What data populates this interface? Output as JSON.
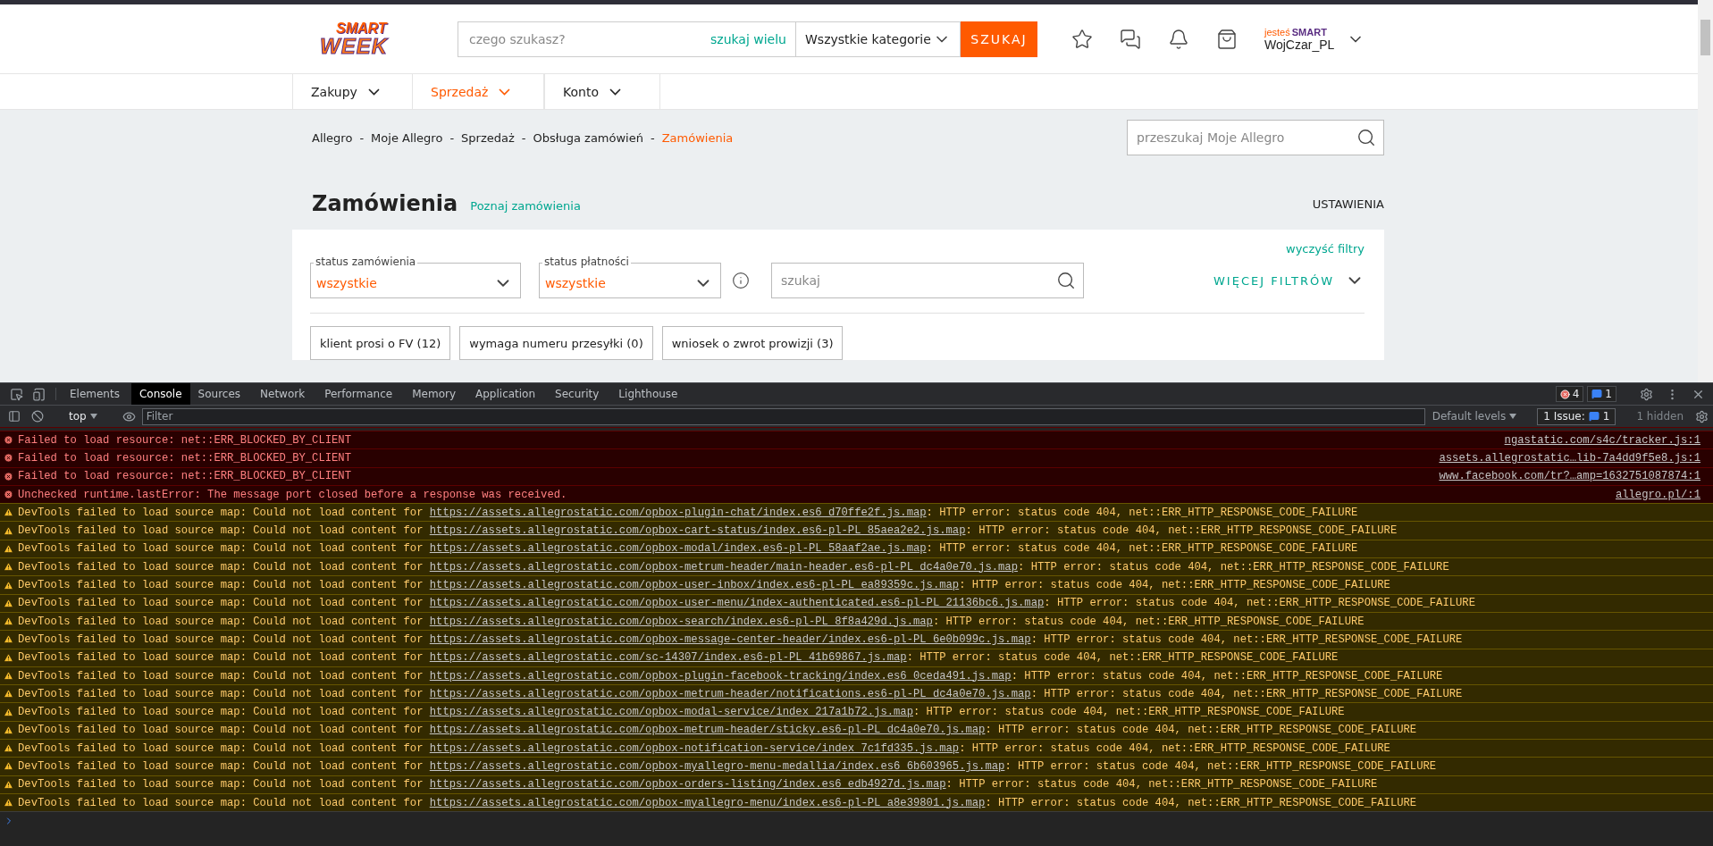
{
  "header": {
    "logo": {
      "top": "SMART",
      "bottom": "WEEK"
    },
    "search": {
      "placeholder": "czego szukasz?",
      "multi_link": "szukaj wielu"
    },
    "category": "Wszystkie kategorie",
    "search_button": "SZUKAJ",
    "user": {
      "badge_prefix": "jesteś",
      "badge_brand": "SMART",
      "name": "WojCzar_PL"
    }
  },
  "nav": [
    {
      "label": "Zakupy",
      "selected": false
    },
    {
      "label": "Sprzedaż",
      "selected": true
    },
    {
      "label": "Konto",
      "selected": false
    }
  ],
  "breadcrumb": [
    {
      "label": "Allegro",
      "selected": false
    },
    {
      "label": "Moje Allegro",
      "selected": false
    },
    {
      "label": "Sprzedaż",
      "selected": false
    },
    {
      "label": "Obsługa zamówień",
      "selected": false
    },
    {
      "label": "Zamówienia",
      "selected": true
    }
  ],
  "breadcrumb_separators": [
    "-",
    "-",
    "-",
    "-"
  ],
  "my_search": {
    "placeholder": "przeszukaj Moje Allegro"
  },
  "page": {
    "title": "Zamówienia",
    "link": "Poznaj zamówienia",
    "settings": "USTAWIENIA"
  },
  "filters": {
    "clear": "wyczyść filtry",
    "selects": [
      {
        "label": "status zamówienia",
        "value": "wszystkie"
      },
      {
        "label": "status płatności",
        "value": "wszystkie"
      }
    ],
    "search": {
      "placeholder": "szukaj"
    },
    "more": "WIĘCEJ FILTRÓW",
    "chips": [
      "klient prosi o FV (12)",
      "wymaga numeru przesyłki (0)",
      "wniosek o zwrot prowizji (3)"
    ]
  },
  "devtools": {
    "tabs": [
      {
        "label": "Elements",
        "selected": false
      },
      {
        "label": "Console",
        "selected": true
      },
      {
        "label": "Sources",
        "selected": false
      },
      {
        "label": "Network",
        "selected": false
      },
      {
        "label": "Performance",
        "selected": false
      },
      {
        "label": "Memory",
        "selected": false
      },
      {
        "label": "Application",
        "selected": false
      },
      {
        "label": "Security",
        "selected": false
      },
      {
        "label": "Lighthouse",
        "selected": false
      }
    ],
    "error_count": "4",
    "message_count": "1",
    "context": "top",
    "filter": {
      "placeholder": "Filter"
    },
    "levels": "Default levels",
    "issues": {
      "label": "1 Issue:",
      "count": "1"
    },
    "hidden": "1 hidden",
    "messages": [
      {
        "kind": "error",
        "text": "Failed to load resource: net::ERR_BLOCKED_BY_CLIENT",
        "source": "ngastatic.com/s4c/tracker.js:1"
      },
      {
        "kind": "error",
        "text": "Failed to load resource: net::ERR_BLOCKED_BY_CLIENT",
        "source": "assets.allegrostatic…lib-7a4dd9f5e8.js:1"
      },
      {
        "kind": "error",
        "text": "Failed to load resource: net::ERR_BLOCKED_BY_CLIENT",
        "source": "www.facebook.com/tr?…amp=1632751087874:1"
      },
      {
        "kind": "error",
        "text": "Unchecked runtime.lastError: The message port closed before a response was received.",
        "source": "allegro.pl/:1"
      },
      {
        "kind": "warning",
        "text": "DevTools failed to load source map: Could not load content for ",
        "url": "https://assets.allegrostatic.com/opbox-plugin-chat/index.es6_d70ffe2f.js.map",
        "suffix": ": HTTP error: status code 404, net::ERR_HTTP_RESPONSE_CODE_FAILURE"
      },
      {
        "kind": "warning",
        "text": "DevTools failed to load source map: Could not load content for ",
        "url": "https://assets.allegrostatic.com/opbox-cart-status/index.es6-pl-PL_85aea2e2.js.map",
        "suffix": ": HTTP error: status code 404, net::ERR_HTTP_RESPONSE_CODE_FAILURE"
      },
      {
        "kind": "warning",
        "text": "DevTools failed to load source map: Could not load content for ",
        "url": "https://assets.allegrostatic.com/opbox-modal/index.es6-pl-PL_58aaf2ae.js.map",
        "suffix": ": HTTP error: status code 404, net::ERR_HTTP_RESPONSE_CODE_FAILURE"
      },
      {
        "kind": "warning",
        "text": "DevTools failed to load source map: Could not load content for ",
        "url": "https://assets.allegrostatic.com/opbox-metrum-header/main-header.es6-pl-PL_dc4a0e70.js.map",
        "suffix": ": HTTP error: status code 404, net::ERR_HTTP_RESPONSE_CODE_FAILURE"
      },
      {
        "kind": "warning",
        "text": "DevTools failed to load source map: Could not load content for ",
        "url": "https://assets.allegrostatic.com/opbox-user-inbox/index.es6-pl-PL_ea89359c.js.map",
        "suffix": ": HTTP error: status code 404, net::ERR_HTTP_RESPONSE_CODE_FAILURE"
      },
      {
        "kind": "warning",
        "text": "DevTools failed to load source map: Could not load content for ",
        "url": "https://assets.allegrostatic.com/opbox-user-menu/index-authenticated.es6-pl-PL_21136bc6.js.map",
        "suffix": ": HTTP error: status code 404, net::ERR_HTTP_RESPONSE_CODE_FAILURE"
      },
      {
        "kind": "warning",
        "text": "DevTools failed to load source map: Could not load content for ",
        "url": "https://assets.allegrostatic.com/opbox-search/index.es6-pl-PL_8f8a429d.js.map",
        "suffix": ": HTTP error: status code 404, net::ERR_HTTP_RESPONSE_CODE_FAILURE"
      },
      {
        "kind": "warning",
        "text": "DevTools failed to load source map: Could not load content for ",
        "url": "https://assets.allegrostatic.com/opbox-message-center-header/index.es6-pl-PL_6e0b099c.js.map",
        "suffix": ": HTTP error: status code 404, net::ERR_HTTP_RESPONSE_CODE_FAILURE"
      },
      {
        "kind": "warning",
        "text": "DevTools failed to load source map: Could not load content for ",
        "url": "https://assets.allegrostatic.com/sc-14307/index.es6-pl-PL_41b69867.js.map",
        "suffix": ": HTTP error: status code 404, net::ERR_HTTP_RESPONSE_CODE_FAILURE"
      },
      {
        "kind": "warning",
        "text": "DevTools failed to load source map: Could not load content for ",
        "url": "https://assets.allegrostatic.com/opbox-plugin-facebook-tracking/index.es6_0ceda491.js.map",
        "suffix": ": HTTP error: status code 404, net::ERR_HTTP_RESPONSE_CODE_FAILURE"
      },
      {
        "kind": "warning",
        "text": "DevTools failed to load source map: Could not load content for ",
        "url": "https://assets.allegrostatic.com/opbox-metrum-header/notifications.es6-pl-PL_dc4a0e70.js.map",
        "suffix": ": HTTP error: status code 404, net::ERR_HTTP_RESPONSE_CODE_FAILURE"
      },
      {
        "kind": "warning",
        "text": "DevTools failed to load source map: Could not load content for ",
        "url": "https://assets.allegrostatic.com/opbox-modal-service/index_217a1b72.js.map",
        "suffix": ": HTTP error: status code 404, net::ERR_HTTP_RESPONSE_CODE_FAILURE"
      },
      {
        "kind": "warning",
        "text": "DevTools failed to load source map: Could not load content for ",
        "url": "https://assets.allegrostatic.com/opbox-metrum-header/sticky.es6-pl-PL_dc4a0e70.js.map",
        "suffix": ": HTTP error: status code 404, net::ERR_HTTP_RESPONSE_CODE_FAILURE"
      },
      {
        "kind": "warning",
        "text": "DevTools failed to load source map: Could not load content for ",
        "url": "https://assets.allegrostatic.com/opbox-notification-service/index_7c1fd335.js.map",
        "suffix": ": HTTP error: status code 404, net::ERR_HTTP_RESPONSE_CODE_FAILURE"
      },
      {
        "kind": "warning",
        "text": "DevTools failed to load source map: Could not load content for ",
        "url": "https://assets.allegrostatic.com/opbox-myallegro-menu-medallia/index.es6_6b603965.js.map",
        "suffix": ": HTTP error: status code 404, net::ERR_HTTP_RESPONSE_CODE_FAILURE"
      },
      {
        "kind": "warning",
        "text": "DevTools failed to load source map: Could not load content for ",
        "url": "https://assets.allegrostatic.com/opbox-orders-listing/index.es6_edb4927d.js.map",
        "suffix": ": HTTP error: status code 404, net::ERR_HTTP_RESPONSE_CODE_FAILURE"
      },
      {
        "kind": "warning",
        "text": "DevTools failed to load source map: Could not load content for ",
        "url": "https://assets.allegrostatic.com/opbox-myallegro-menu/index.es6-pl-PL_a8e39801.js.map",
        "suffix": ": HTTP error: status code 404, net::ERR_HTTP_RESPONSE_CODE_FAILURE"
      }
    ]
  }
}
